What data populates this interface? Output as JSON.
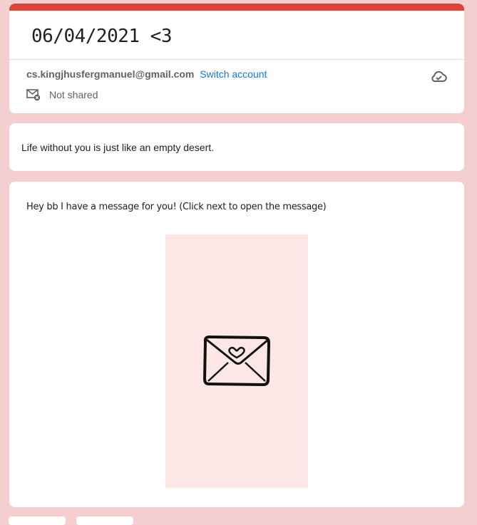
{
  "form": {
    "title": "06/04/2021 <3",
    "accent_color": "#db4437",
    "background_color": "#f5cfcf"
  },
  "account": {
    "email": "cs.kingjhusfergmanuel@gmail.com",
    "switch_label": "Switch account",
    "shared_status": "Not shared",
    "icons": [
      "cloud-saved-icon",
      "mail-not-shared-icon"
    ]
  },
  "description": {
    "text": "Life without you is just like an empty desert."
  },
  "message_section": {
    "text": "Hey bb I have a message for you! (Click next to open the message)",
    "image": {
      "icon": "envelope-heart-icon",
      "background_color": "#fce6e6"
    }
  }
}
